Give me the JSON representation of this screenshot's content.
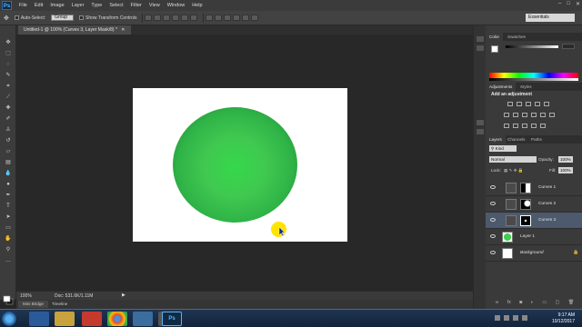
{
  "app": {
    "logo": "Ps"
  },
  "menu": [
    "File",
    "Edit",
    "Image",
    "Layer",
    "Type",
    "Select",
    "Filter",
    "View",
    "Window",
    "Help"
  ],
  "options": {
    "auto_select_label": "Auto-Select:",
    "auto_select_value": "Group",
    "show_transform_label": "Show Transform Controls",
    "workspace": "Essentials"
  },
  "document": {
    "tab_title": "Untitled-1 @ 100% (Curves 3, Layer Mask/8) *",
    "zoom": "100%",
    "doc_info": "Doc: 531.6K/1.11M"
  },
  "bottom_tabs": [
    "Mini Bridge",
    "Timeline"
  ],
  "color_panel": {
    "tabs": [
      "Color",
      "Swatches"
    ]
  },
  "adjustments_panel": {
    "tabs": [
      "Adjustments",
      "Styles"
    ],
    "title": "Add an adjustment"
  },
  "layers_panel": {
    "tabs": [
      "Layers",
      "Channels",
      "Paths"
    ],
    "kind_label": "Kind",
    "blend_mode": "Normal",
    "opacity_label": "Opacity:",
    "opacity_value": "100%",
    "lock_label": "Lock:",
    "fill_label": "Fill:",
    "fill_value": "100%",
    "layers": [
      {
        "name": "Curves 1",
        "selected": false
      },
      {
        "name": "Curves 2",
        "selected": false
      },
      {
        "name": "Curves 3",
        "selected": true
      },
      {
        "name": "Layer 1",
        "selected": false
      },
      {
        "name": "Background",
        "selected": false
      }
    ]
  },
  "taskbar": {
    "time": "9:17 AM",
    "date": "10/12/2017"
  },
  "colors": {
    "sphere": "#35d84b",
    "cursor_highlight": "#ffe400",
    "selected_layer": "#4d5a6e"
  }
}
